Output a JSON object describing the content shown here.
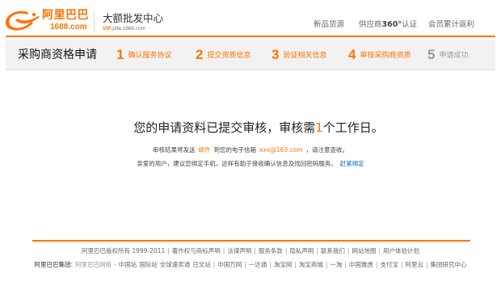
{
  "header": {
    "logo": {
      "brand": "阿里巴巴",
      "domain": "1688.com"
    },
    "site_title": "大额批发中心",
    "site_url": {
      "prefix": "VIP",
      "rest": ".pifa.1688.com"
    },
    "nav": [
      {
        "label": "新品货源"
      },
      {
        "prefix": "供应商",
        "highlight": "360°",
        "suffix": "认证"
      },
      {
        "label": "会员累计返利"
      }
    ]
  },
  "steps_bar": {
    "title": "采购商资格申请",
    "steps": [
      {
        "number": "1",
        "label": "确认服务协议",
        "highlighted": true
      },
      {
        "number": "2",
        "label": "提交资质信息",
        "highlighted": true
      },
      {
        "number": "3",
        "label": "验证相关信息",
        "highlighted": true
      },
      {
        "number": "4",
        "label": "审核采购商资质",
        "highlighted": true
      },
      {
        "number": "5",
        "label": "申请成功",
        "highlighted": false
      }
    ]
  },
  "main": {
    "heading": {
      "before": "您的申请资料已提交审核，审核需",
      "days": "1",
      "after": "个工作日。"
    },
    "notice": {
      "before": "审核结果将发送",
      "method": "邮件",
      "middle": "到您的电子信箱",
      "email": "xxx@163.com",
      "after": "，请注意查收。"
    },
    "suggestion": {
      "text": "亲爱的用户，建议您绑定手机，这样有助于接收确认信息及找回密码服务。",
      "link_label": "赶紧绑定"
    }
  },
  "footer": {
    "copyright": "阿里巴巴版权所有 1999-2011",
    "links": [
      "著作权与商标声明",
      "法律声明",
      "服务条款",
      "隐私声明",
      "联系我们",
      "网站地图",
      "用户体验计划"
    ],
    "group": {
      "label": "阿里巴巴集团:",
      "network": "阿里巴巴网络",
      "dash": "-",
      "network_sites": [
        "中国站",
        "国际站",
        "全球速卖通",
        "日文站"
      ],
      "sites": [
        "中国万网",
        "一达通",
        "淘宝网",
        "淘宝商城",
        "一淘",
        "中国雅虎",
        "支付宝",
        "阿里云",
        "集团研究中心"
      ]
    }
  },
  "colors": {
    "accent": "#ff7300",
    "link": "#1a66b3",
    "muted": "#999999"
  }
}
